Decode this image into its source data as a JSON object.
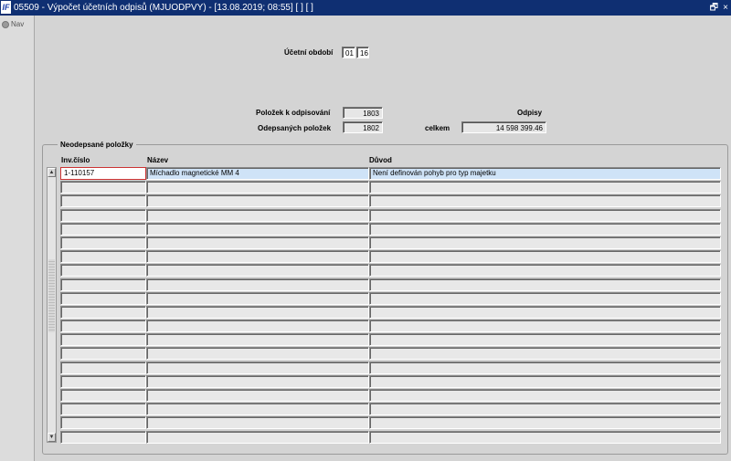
{
  "window": {
    "title": "05509 - Výpočet účetních odpisů (MJUODPVY) - [13.08.2019; 08:55]  [ ]  [ ]",
    "app_icon": "IF",
    "restore_glyph": "🗗",
    "close_glyph": "×"
  },
  "nav": {
    "label": "Nav"
  },
  "period": {
    "label": "Účetní období",
    "month": "01",
    "year": "16"
  },
  "summary": {
    "items_label": "Položek k odpisování",
    "items_value": "1803",
    "done_label": "Odepsaných položek",
    "done_value": "1802",
    "odpisy_label": "Odpisy",
    "total_label": "celkem",
    "total_value": "14 598 399.46"
  },
  "table": {
    "group_title": "Neodepsané položky",
    "columns": [
      "Inv.číslo",
      "Název",
      "Důvod"
    ],
    "rows": [
      [
        "1-110157",
        "Míchadlo magnetické MM 4",
        "Není definován pohyb pro typ majetku"
      ],
      [
        "",
        "",
        ""
      ],
      [
        "",
        "",
        ""
      ],
      [
        "",
        "",
        ""
      ],
      [
        "",
        "",
        ""
      ],
      [
        "",
        "",
        ""
      ],
      [
        "",
        "",
        ""
      ],
      [
        "",
        "",
        ""
      ],
      [
        "",
        "",
        ""
      ],
      [
        "",
        "",
        ""
      ],
      [
        "",
        "",
        ""
      ],
      [
        "",
        "",
        ""
      ],
      [
        "",
        "",
        ""
      ],
      [
        "",
        "",
        ""
      ],
      [
        "",
        "",
        ""
      ],
      [
        "",
        "",
        ""
      ],
      [
        "",
        "",
        ""
      ],
      [
        "",
        "",
        ""
      ],
      [
        "",
        "",
        ""
      ],
      [
        "",
        "",
        ""
      ]
    ]
  }
}
